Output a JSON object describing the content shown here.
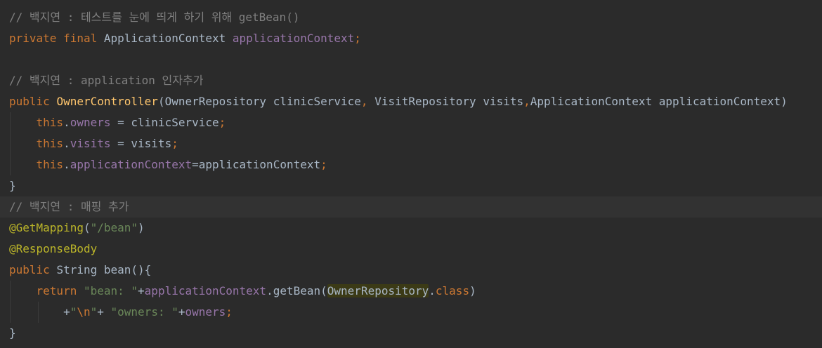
{
  "code": {
    "l1": {
      "comment": "// 백지연 : 테스트를 눈에 띄게 하기 위해 getBean()"
    },
    "l2": {
      "kw": "private final ",
      "type": "ApplicationContext ",
      "field": "applicationContext",
      "semi": ";"
    },
    "l4": {
      "comment": "// 백지연 : application 인자추가"
    },
    "l5": {
      "kw": "public ",
      "fn": "OwnerController",
      "p1": "(OwnerRepository clinicService",
      "c1": ", ",
      "p2": "VisitRepository visits",
      "c2": ",",
      "p3": "ApplicationContext applicationContext)"
    },
    "l6": {
      "this": "this",
      "dot": ".",
      "field": "owners",
      "rest": " = clinicService",
      "semi": ";"
    },
    "l7": {
      "this": "this",
      "dot": ".",
      "field": "visits",
      "rest": " = visits",
      "semi": ";"
    },
    "l8": {
      "this": "this",
      "dot": ".",
      "field": "applicationContext",
      "rest": "=applicationContext",
      "semi": ";"
    },
    "l9": {
      "brace": "}"
    },
    "l10": {
      "comment": "// 백지연 : 매핑 추가"
    },
    "l11": {
      "ann": "@GetMapping",
      "open": "(",
      "str": "\"/bean\"",
      "close": ")"
    },
    "l12": {
      "ann": "@ResponseBody"
    },
    "l13": {
      "kw": "public ",
      "type": "String ",
      "name": "bean",
      "rest": "(){"
    },
    "l14": {
      "kw": "return ",
      "str": "\"bean: \"",
      "plus": "+",
      "field": "applicationContext",
      "call": ".getBean(",
      "hl": "OwnerRepository",
      "dot": ".",
      "cls": "class",
      "close": ")"
    },
    "l15": {
      "plus1": "+",
      "q1": "\"",
      "esc": "\\n",
      "q2": "\"",
      "plus2": "+ ",
      "str": "\"owners: \"",
      "plus3": "+",
      "field": "owners",
      "semi": ";"
    },
    "l16": {
      "brace": "}"
    }
  },
  "colors": {
    "background": "#2b2b2b",
    "current_line": "#323232",
    "comment": "#808080",
    "keyword": "#cc7832",
    "function": "#ffc66d",
    "field": "#9876aa",
    "string": "#6a8759",
    "annotation": "#bbb529",
    "text": "#a9b7c6",
    "highlight": "#3b3a16"
  }
}
